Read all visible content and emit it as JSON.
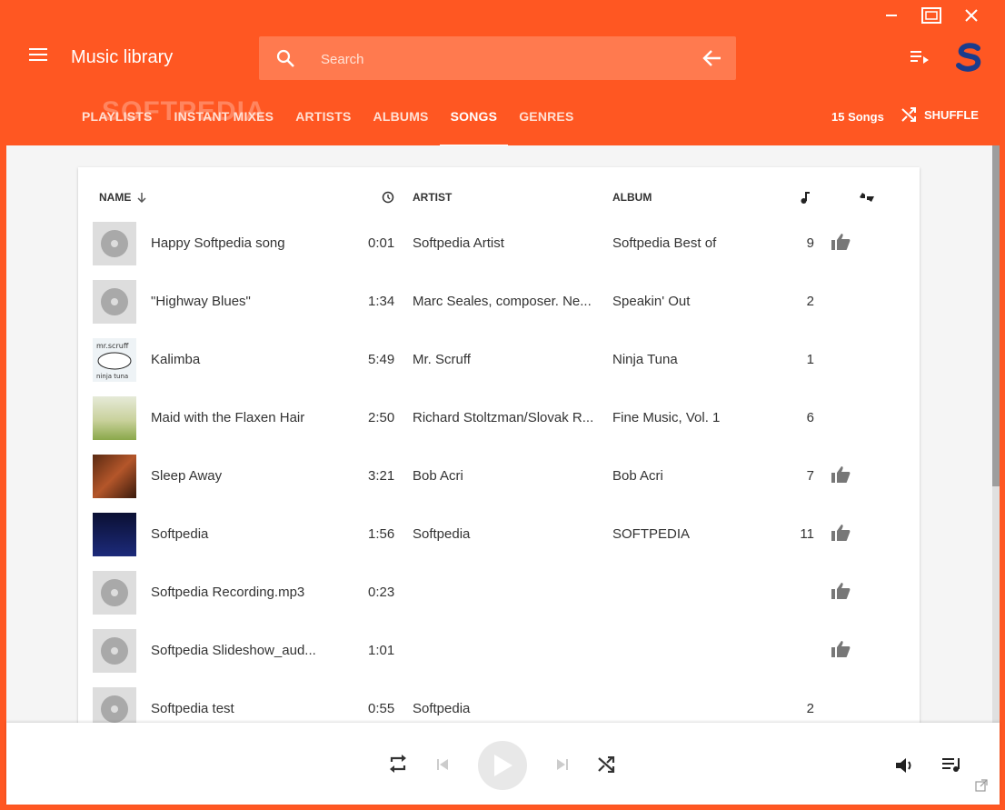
{
  "app": {
    "title": "Music library"
  },
  "search": {
    "placeholder": "Search"
  },
  "tabs": [
    "PLAYLISTS",
    "INSTANT MIXES",
    "ARTISTS",
    "ALBUMS",
    "SONGS",
    "GENRES"
  ],
  "active_tab": "SONGS",
  "watermark": "SOFTPEDIA",
  "song_count": "15 Songs",
  "shuffle_label": "SHUFFLE",
  "columns": {
    "name": "NAME",
    "artist": "ARTIST",
    "album": "ALBUM"
  },
  "songs": [
    {
      "name": "Happy Softpedia song",
      "duration": "0:01",
      "artist": "Softpedia Artist",
      "album": "Softpedia Best of",
      "track": "9",
      "liked": true,
      "art": "disc"
    },
    {
      "name": "\"Highway Blues\"",
      "duration": "1:34",
      "artist": "Marc Seales, composer. Ne...",
      "album": "Speakin' Out",
      "track": "2",
      "liked": false,
      "art": "disc"
    },
    {
      "name": "Kalimba",
      "duration": "5:49",
      "artist": "Mr. Scruff",
      "album": "Ninja Tuna",
      "track": "1",
      "liked": false,
      "art": "kalimba"
    },
    {
      "name": "Maid with the Flaxen Hair",
      "duration": "2:50",
      "artist": "Richard Stoltzman/Slovak R...",
      "album": "Fine Music, Vol. 1",
      "track": "6",
      "liked": false,
      "art": "maid"
    },
    {
      "name": "Sleep Away",
      "duration": "3:21",
      "artist": "Bob Acri",
      "album": "Bob Acri",
      "track": "7",
      "liked": true,
      "art": "sleep"
    },
    {
      "name": "Softpedia",
      "duration": "1:56",
      "artist": "Softpedia",
      "album": "SOFTPEDIA",
      "track": "11",
      "liked": true,
      "art": "softpedia"
    },
    {
      "name": "Softpedia Recording.mp3",
      "duration": "0:23",
      "artist": "",
      "album": "",
      "track": "",
      "liked": true,
      "art": "disc"
    },
    {
      "name": "Softpedia Slideshow_aud...",
      "duration": "1:01",
      "artist": "",
      "album": "",
      "track": "",
      "liked": true,
      "art": "disc"
    },
    {
      "name": "Softpedia test",
      "duration": "0:55",
      "artist": "Softpedia",
      "album": "",
      "track": "2",
      "liked": false,
      "art": "disc"
    }
  ],
  "colors": {
    "accent": "#ff5722",
    "accent_light": "#ff7a4f",
    "text": "#333333"
  },
  "icons": {
    "menu": "hamburger-icon",
    "search": "search-icon",
    "back": "arrow-left-icon",
    "queue": "queue-icon",
    "logo": "logo-icon",
    "shuffle": "shuffle-icon",
    "repeat": "repeat-icon",
    "prev": "skip-previous-icon",
    "play": "play-icon",
    "next": "skip-next-icon",
    "volume": "volume-icon",
    "open": "open-external-icon",
    "like": "thumb-up-icon",
    "rating": "thumbs-icon",
    "duration": "clock-icon",
    "track": "music-note-icon"
  }
}
